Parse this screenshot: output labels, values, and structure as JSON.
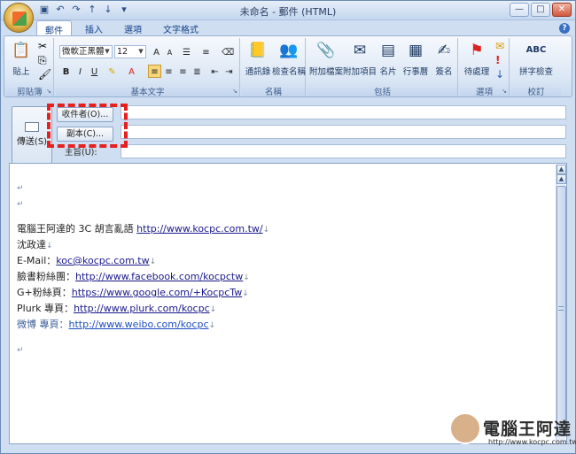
{
  "window": {
    "title": "未命名 - 郵件 (HTML)",
    "controls": [
      "—",
      "□",
      "✕"
    ]
  },
  "tabs": [
    {
      "label": "郵件",
      "active": true
    },
    {
      "label": "插入",
      "active": false
    },
    {
      "label": "選項",
      "active": false
    },
    {
      "label": "文字格式",
      "active": false
    }
  ],
  "ribbon": {
    "clipboard": {
      "label": "剪貼簿",
      "paste": "貼上"
    },
    "basic_text": {
      "label": "基本文字",
      "font": "微軟正黑體",
      "size": "12",
      "bold": "B",
      "italic": "I",
      "underline": "U"
    },
    "names": {
      "label": "名稱",
      "address_book": "通訊錄",
      "check_names": "檢查名稱"
    },
    "include": {
      "label": "包括",
      "attach_file": "附加檔案",
      "attach_item": "附加項目",
      "business_card": "名片",
      "calendar": "行事曆",
      "signature": "簽名"
    },
    "options": {
      "label": "選項",
      "follow_up": "待處理"
    },
    "proofing": {
      "label": "校訂",
      "spelling": "拼字檢查",
      "abc": "ABC"
    }
  },
  "header": {
    "send": "傳送(S)",
    "to_button": "收件者(O)...",
    "cc_button": "副本(C)...",
    "subject_label": "主旨(U):",
    "to_value": "",
    "cc_value": "",
    "subject_value": ""
  },
  "body": {
    "paragraph_mark": "↵",
    "line_mark": "↓",
    "lines": [
      {
        "text": "電腦王阿達的 3C 胡言亂語 ",
        "link": "http://www.kocpc.com.tw/"
      },
      {
        "text": "沈政達",
        "link": ""
      },
      {
        "text": "E-Mail：",
        "link": "koc@kocpc.com.tw"
      },
      {
        "text": "臉書粉絲團：",
        "link": "http://www.facebook.com/kocpctw"
      },
      {
        "text": "G+粉絲頁：",
        "link": "https://www.google.com/+KocpcTw"
      },
      {
        "text": "Plurk 專頁：",
        "link": "http://www.plurk.com/kocpc"
      },
      {
        "text": "微博 專頁：",
        "link": "http://www.weibo.com/kocpc"
      }
    ]
  },
  "watermark": {
    "name": "電腦王阿達",
    "url": "http://www.kocpc.com.tw"
  },
  "colors": {
    "ribbon_bg": "#dbe7f5",
    "highlight": "#e52020",
    "link": "#1a1a8c"
  }
}
